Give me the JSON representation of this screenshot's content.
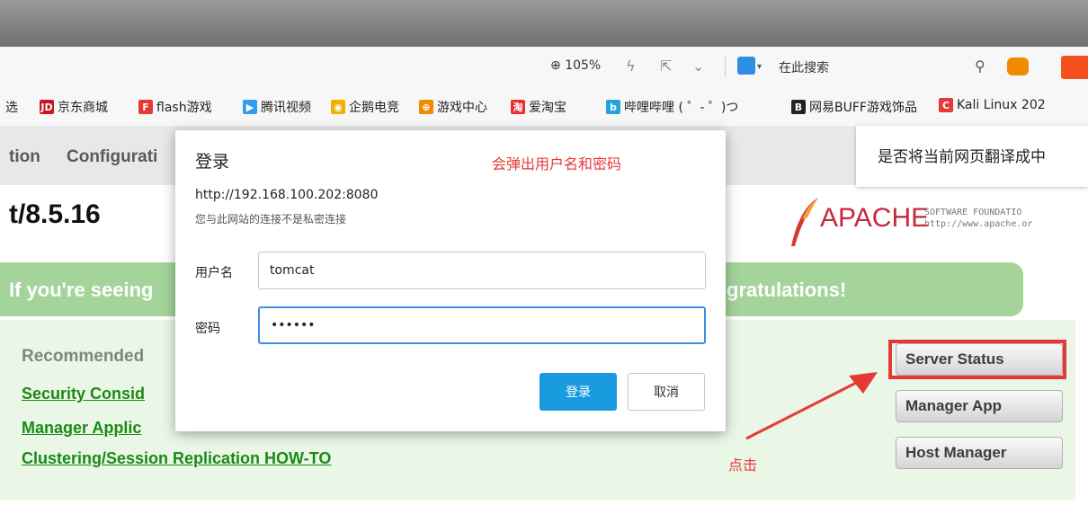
{
  "toolbar": {
    "zoom_text": "105%",
    "search_label": "在此搜索"
  },
  "bookmarks": [
    {
      "label": "选",
      "icon": "",
      "color": ""
    },
    {
      "label": "京东商城",
      "icon": "JD",
      "color": "#c81623"
    },
    {
      "label": "flash游戏",
      "icon": "F",
      "color": "#e53935"
    },
    {
      "label": "腾讯视频",
      "icon": "▶",
      "color": "#2f9df2"
    },
    {
      "label": "企鹅电竞",
      "icon": "◉",
      "color": "#f0b000"
    },
    {
      "label": "游戏中心",
      "icon": "⊕",
      "color": "#f08a00"
    },
    {
      "label": "爱淘宝",
      "icon": "淘",
      "color": "#e8312f"
    },
    {
      "label": "哔哩哔哩 ( ゜- ゜)つ",
      "icon": "b",
      "color": "#23a3dd"
    },
    {
      "label": "网易BUFF游戏饰品",
      "icon": "B",
      "color": "#222222"
    },
    {
      "label": "Kali Linux 202",
      "icon": "C",
      "color": "#e53935"
    }
  ],
  "nav": {
    "item1": "tion",
    "item2": "Configurati"
  },
  "translate_prompt": "是否将当前网页翻译成中",
  "version_text": "t/8.5.16",
  "apache": {
    "word": "APACHE",
    "sf_line1": "SOFTWARE FOUNDATIO",
    "sf_line2": "http://www.apache.or"
  },
  "banner": {
    "left_text": "If you're seeing",
    "right_text": "gratulations!"
  },
  "recommended": "Recommended",
  "links": [
    "Security Consid",
    "Manager Applic",
    "Clustering/Session Replication HOW-TO"
  ],
  "buttons": {
    "server_status": "Server Status",
    "manager_app": "Manager App",
    "host_manager": "Host Manager"
  },
  "annotation": {
    "popup_note": "会弹出用户名和密码",
    "click_note": "点击",
    "color": "#e53935"
  },
  "dialog": {
    "title": "登录",
    "url": "http://192.168.100.202:8080",
    "warning": "您与此网站的连接不是私密连接",
    "username_label": "用户名",
    "username_value": "tomcat",
    "password_label": "密码",
    "password_value": "••••••",
    "login_button": "登录",
    "cancel_button": "取消"
  }
}
